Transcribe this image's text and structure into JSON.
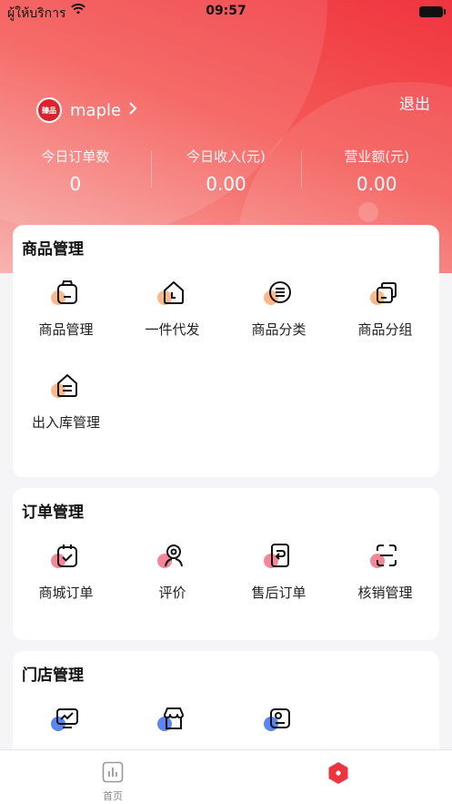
{
  "status_bar": {
    "carrier": "ผู้ให้บริการ",
    "time": "09:57"
  },
  "header": {
    "avatar_text": "臻品",
    "username": "maple",
    "logout_label": "退出",
    "stats": [
      {
        "label": "今日订单数",
        "value": "0"
      },
      {
        "label": "今日收入(元)",
        "value": "0.00"
      },
      {
        "label": "营业额(元)",
        "value": "0.00"
      }
    ]
  },
  "sections": {
    "goods": {
      "title": "商品管理",
      "items": [
        {
          "label": "商品管理",
          "icon": "bag-icon"
        },
        {
          "label": "一件代发",
          "icon": "house-icon"
        },
        {
          "label": "商品分类",
          "icon": "list-circle-icon"
        },
        {
          "label": "商品分组",
          "icon": "stack-icon"
        },
        {
          "label": "出入库管理",
          "icon": "warehouse-icon"
        }
      ]
    },
    "orders": {
      "title": "订单管理",
      "items": [
        {
          "label": "商城订单",
          "icon": "calendar-check-icon"
        },
        {
          "label": "评价",
          "icon": "location-user-icon"
        },
        {
          "label": "售后订单",
          "icon": "return-doc-icon"
        },
        {
          "label": "核销管理",
          "icon": "scan-icon"
        }
      ]
    },
    "store": {
      "title": "门店管理",
      "items": [
        {
          "icon": "chart-monitor-icon"
        },
        {
          "icon": "store-icon"
        },
        {
          "icon": "id-card-icon"
        }
      ]
    }
  },
  "tabbar": {
    "home_label": "首页",
    "home_icon": "bar-chart-icon",
    "second_icon": "hexagon-icon"
  },
  "colors": {
    "brand_red": "#f0343f",
    "orange_shade": "#f9b98a",
    "pink_shade": "#f5869a",
    "blue_shade": "#5b86f2"
  }
}
